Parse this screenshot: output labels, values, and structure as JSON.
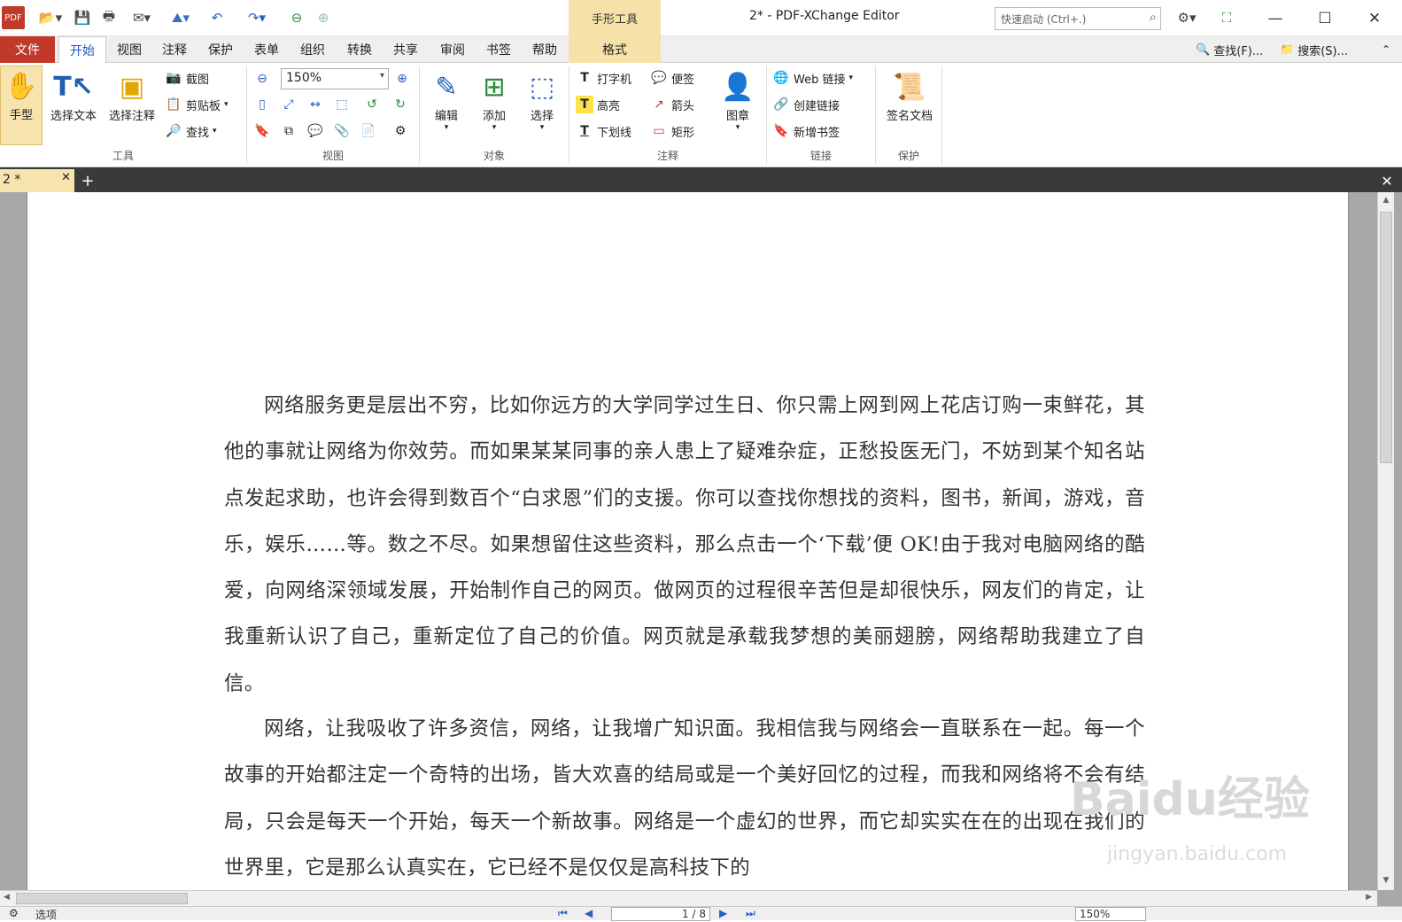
{
  "window": {
    "title": "2* - PDF-XChange Editor",
    "context_header": "手形工具",
    "quick_launch_placeholder": "快速启动 (Ctrl+.)"
  },
  "menu": {
    "file": "文件",
    "tabs": [
      "开始",
      "视图",
      "注释",
      "保护",
      "表单",
      "组织",
      "转换",
      "共享",
      "审阅",
      "书签",
      "帮助"
    ],
    "active_tab": "开始",
    "context_tab": "格式",
    "find": "查找(F)...",
    "search": "搜索(S)..."
  },
  "ribbon": {
    "tools": {
      "label": "工具",
      "hand": "手型",
      "select_text": "选择文本",
      "select_annot": "选择注释",
      "snapshot": "截图",
      "clipboard": "剪贴板",
      "find": "查找"
    },
    "view": {
      "label": "视图",
      "zoom": "150%"
    },
    "objects": {
      "label": "对象",
      "edit": "编辑",
      "add": "添加",
      "select": "选择"
    },
    "annotate": {
      "label": "注释",
      "typewriter": "打字机",
      "sticky": "便签",
      "highlight": "高亮",
      "arrow": "箭头",
      "underline": "下划线",
      "rectangle": "矩形",
      "stamp": "图章"
    },
    "links": {
      "label": "链接",
      "web_links": "Web 链接",
      "create_link": "创建链接",
      "add_bookmark": "新增书签"
    },
    "protect": {
      "label": "保护",
      "sign": "签名文档"
    }
  },
  "doc_tab": {
    "name": "2 *"
  },
  "document": {
    "paragraph1": "网络服务更是层出不穷，比如你远方的大学同学过生日、你只需上网到网上花店订购一束鲜花，其他的事就让网络为你效劳。而如果某某同事的亲人患上了疑难杂症，正愁投医无门，不妨到某个知名站点发起求助，也许会得到数百个“白求恩”们的支援。你可以查找你想找的资料，图书，新闻，游戏，音乐，娱乐……等。数之不尽。如果想留住这些资料，那么点击一个‘下载’便 OK!由于我对电脑网络的酷爱，向网络深领域发展，开始制作自己的网页。做网页的过程很辛苦但是却很快乐，网友们的肯定，让我重新认识了自己，重新定位了自己的价值。网页就是承载我梦想的美丽翅膀，网络帮助我建立了自信。",
    "paragraph2": "网络，让我吸收了许多资信，网络，让我增广知识面。我相信我与网络会一直联系在一起。每一个故事的开始都注定一个奇特的出场，皆大欢喜的结局或是一个美好回忆的过程，而我和网络将不会有结局，只会是每天一个开始，每天一个新故事。网络是一个虚幻的世界，而它却实实在在的出现在我们的世界里，它是那么认真实在，它已经不是仅仅是高科技下的"
  },
  "status": {
    "options": "选项",
    "page": "1 / 8",
    "zoom": "150%"
  },
  "watermark": {
    "brand": "Baidu经验",
    "url": "jingyan.baidu.com"
  },
  "colors": {
    "file_tab": "#c0392b",
    "context_tab": "#f6e2a8",
    "accent": "#1a55c0"
  }
}
